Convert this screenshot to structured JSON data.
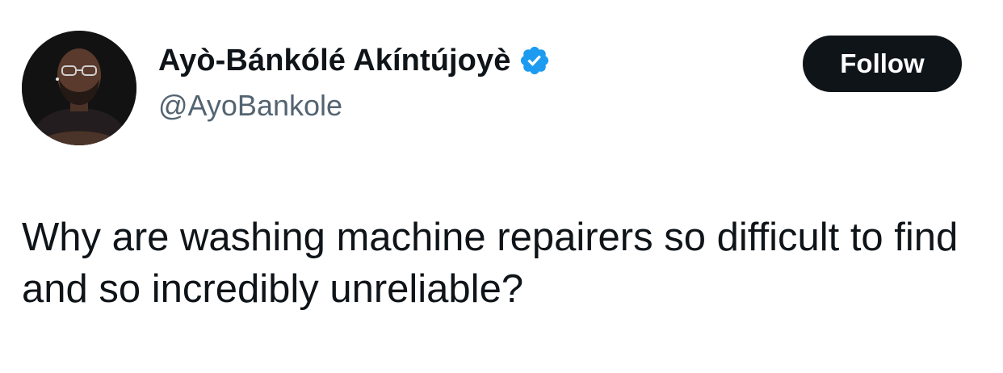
{
  "author": {
    "display_name": "Ayò-Bánkólé Akíntújoyè",
    "handle": "@AyoBankole",
    "verified": true,
    "verified_color": "#1d9bf0"
  },
  "actions": {
    "follow_label": "Follow"
  },
  "tweet": {
    "text": "Why are washing machine repairers so difficult to find and so incredibly unreliable?"
  },
  "colors": {
    "text_primary": "#0f1419",
    "text_secondary": "#536471",
    "button_bg": "#0f1419",
    "button_text": "#ffffff"
  },
  "icons": {
    "verified": "verified-badge-icon",
    "avatar": "profile-photo"
  }
}
